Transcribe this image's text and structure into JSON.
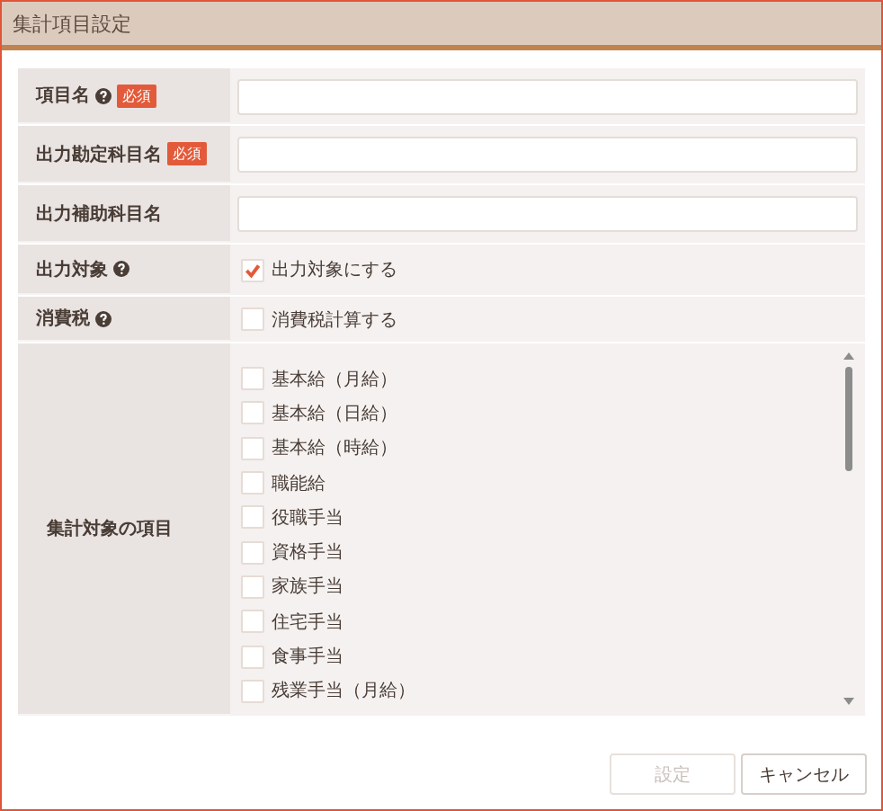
{
  "window": {
    "title": "集計項目設定"
  },
  "fields": [
    {
      "kind": "text",
      "label": "項目名",
      "help": true,
      "required": "必須"
    },
    {
      "kind": "text",
      "label": "出力勘定科目名",
      "help": false,
      "required": "必須"
    },
    {
      "kind": "text",
      "label": "出力補助科目名",
      "help": false
    },
    {
      "kind": "checkbox",
      "label": "出力対象",
      "help": true,
      "option": "出力対象にする",
      "checked": true
    },
    {
      "kind": "checkbox",
      "label": "消費税",
      "help": true,
      "option": "消費税計算する",
      "checked": false
    },
    {
      "kind": "list",
      "label": "集計対象の項目",
      "items": [
        {
          "label": "基本給（月給）",
          "checked": false
        },
        {
          "label": "基本給（日給）",
          "checked": false
        },
        {
          "label": "基本給（時給）",
          "checked": false
        },
        {
          "label": "職能給",
          "checked": false
        },
        {
          "label": "役職手当",
          "checked": false
        },
        {
          "label": "資格手当",
          "checked": false
        },
        {
          "label": "家族手当",
          "checked": false
        },
        {
          "label": "住宅手当",
          "checked": false
        },
        {
          "label": "食事手当",
          "checked": false
        },
        {
          "label": "残業手当（月給）",
          "checked": false
        }
      ]
    }
  ],
  "buttons": [
    {
      "label": "設定",
      "disabled": true
    },
    {
      "label": "キャンセル",
      "disabled": false
    }
  ]
}
